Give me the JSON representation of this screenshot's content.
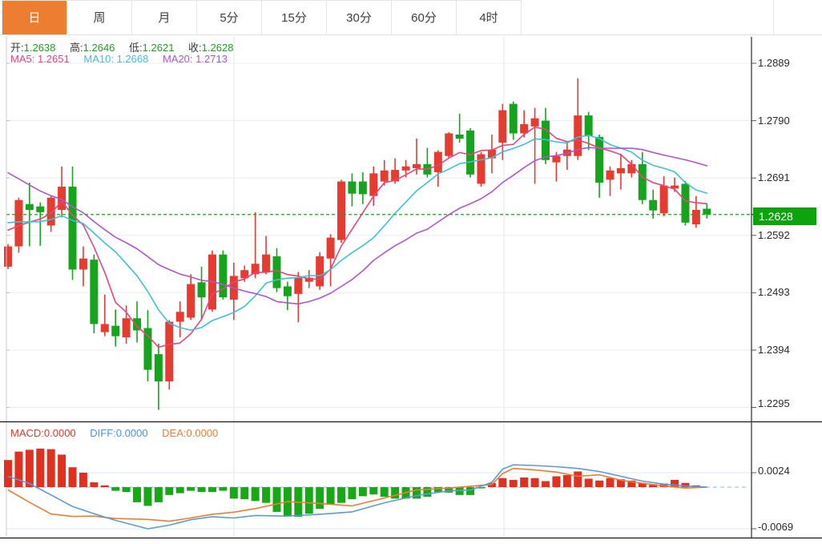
{
  "tabs": {
    "items": [
      {
        "label": "日",
        "active": true
      },
      {
        "label": "周",
        "active": false
      },
      {
        "label": "月",
        "active": false
      },
      {
        "label": "5分",
        "active": false
      },
      {
        "label": "15分",
        "active": false
      },
      {
        "label": "30分",
        "active": false
      },
      {
        "label": "60分",
        "active": false
      },
      {
        "label": "4时",
        "active": false
      }
    ]
  },
  "ohlc_legend": {
    "open_label": "开:",
    "open": "1.2638",
    "high_label": "高:",
    "high": "1.2646",
    "low_label": "低:",
    "low": "1.2621",
    "close_label": "收:",
    "close": "1.2628"
  },
  "ma_legend": {
    "ma5_label": "MA5:",
    "ma5": "1.2651",
    "ma10_label": "MA10:",
    "ma10": "1.2668",
    "ma20_label": "MA20:",
    "ma20": "1.2713"
  },
  "macd_legend": {
    "macd_label": "MACD:",
    "macd": "0.0000",
    "diff_label": "DIFF:",
    "diff": "0.0000",
    "dea_label": "DEA:",
    "dea": "0.0000"
  },
  "price_axis": {
    "ticks": [
      "1.2889",
      "1.2790",
      "1.2691",
      "1.2592",
      "1.2493",
      "1.2394",
      "1.2295"
    ],
    "current": "1.2628"
  },
  "macd_axis": {
    "ticks": [
      "0.0024",
      "-0.0069"
    ]
  },
  "colors": {
    "up": "#e53b30",
    "down": "#16a41e",
    "hist_up": "#e03020",
    "hist_down": "#17a717",
    "ma5": "#e8447d",
    "ma10": "#3ec0d8",
    "ma20": "#b156c9",
    "diff": "#5b9bd5",
    "dea": "#ed7d31",
    "current_line": "#1ea21e",
    "badge": "#0ca40c",
    "grid_h": "#e8eef6",
    "grid_v": "#dce7f2",
    "axis_left": "#c9ced4",
    "axis_right": "#3c3c3c",
    "separator": "#1a1a1a",
    "zero_dashed": "#8fc1e8",
    "tab_active_bg": "#ed7d31"
  },
  "chart_data": [
    {
      "type": "candlestick",
      "title": "日K with MA5/MA10/MA20",
      "y_ticks": [
        1.2889,
        1.279,
        1.2691,
        1.2592,
        1.2493,
        1.2394,
        1.2295
      ],
      "current_price": 1.2628,
      "ma_periods": [
        5,
        10,
        20
      ],
      "ma_lead_in_closes": [
        1.286,
        1.285,
        1.2838,
        1.2822,
        1.2804,
        1.2784,
        1.2762,
        1.2742,
        1.272,
        1.2678,
        1.264,
        1.2635,
        1.263,
        1.262,
        1.261,
        1.2615,
        1.2605,
        1.2605,
        1.2607
      ],
      "candles": [
        [
          1.2538,
          1.2577,
          1.2534,
          1.2573
        ],
        [
          1.2573,
          1.2657,
          1.2562,
          1.2653
        ],
        [
          1.2646,
          1.2683,
          1.2573,
          1.2636
        ],
        [
          1.2642,
          1.2649,
          1.2574,
          1.2632
        ],
        [
          1.2609,
          1.2661,
          1.2598,
          1.2657
        ],
        [
          1.2636,
          1.2711,
          1.2623,
          1.2676
        ],
        [
          1.2676,
          1.2711,
          1.2515,
          1.2533
        ],
        [
          1.2533,
          1.2573,
          1.2504,
          1.2552
        ],
        [
          1.255,
          1.2559,
          1.2423,
          1.2439
        ],
        [
          1.2425,
          1.249,
          1.2418,
          1.2439
        ],
        [
          1.2436,
          1.2464,
          1.24,
          1.2418
        ],
        [
          1.2416,
          1.2471,
          1.2405,
          1.2449
        ],
        [
          1.2449,
          1.2478,
          1.2407,
          1.2428
        ],
        [
          1.2432,
          1.2463,
          1.234,
          1.236
        ],
        [
          1.2387,
          1.2405,
          1.2291,
          1.234
        ],
        [
          1.234,
          1.2446,
          1.2326,
          1.2443
        ],
        [
          1.2443,
          1.2478,
          1.2416,
          1.246
        ],
        [
          1.245,
          1.2525,
          1.2446,
          1.2508
        ],
        [
          1.2511,
          1.2538,
          1.2446,
          1.2485
        ],
        [
          1.2464,
          1.2566,
          1.246,
          1.2559
        ],
        [
          1.2559,
          1.2566,
          1.2481,
          1.2485
        ],
        [
          1.2481,
          1.2545,
          1.2446,
          1.2522
        ],
        [
          1.2518,
          1.254,
          1.2512,
          1.2532
        ],
        [
          1.2525,
          1.2632,
          1.2518,
          1.2543
        ],
        [
          1.2529,
          1.2591,
          1.2525,
          1.2559
        ],
        [
          1.2556,
          1.257,
          1.2494,
          1.2501
        ],
        [
          1.2504,
          1.2512,
          1.2463,
          1.2487
        ],
        [
          1.2491,
          1.2529,
          1.2442,
          1.2519
        ],
        [
          1.2512,
          1.2532,
          1.2501,
          1.2519
        ],
        [
          1.2504,
          1.2563,
          1.2498,
          1.2556
        ],
        [
          1.2552,
          1.2594,
          1.2504,
          1.2588
        ],
        [
          1.2584,
          1.2688,
          1.2579,
          1.2685
        ],
        [
          1.2685,
          1.2699,
          1.2642,
          1.2664
        ],
        [
          1.2685,
          1.2701,
          1.2646,
          1.2663
        ],
        [
          1.266,
          1.2711,
          1.2643,
          1.2699
        ],
        [
          1.2685,
          1.2722,
          1.2678,
          1.2704
        ],
        [
          1.2685,
          1.2725,
          1.2681,
          1.2705
        ],
        [
          1.2704,
          1.2722,
          1.2692,
          1.2711
        ],
        [
          1.2708,
          1.2759,
          1.2697,
          1.2715
        ],
        [
          1.2715,
          1.2743,
          1.2692,
          1.2697
        ],
        [
          1.2701,
          1.2739,
          1.2676,
          1.2736
        ],
        [
          1.2729,
          1.277,
          1.2725,
          1.2768
        ],
        [
          1.2766,
          1.2802,
          1.2752,
          1.2759
        ],
        [
          1.2773,
          1.2777,
          1.2692,
          1.2697
        ],
        [
          1.2681,
          1.2736,
          1.2676,
          1.2732
        ],
        [
          1.2725,
          1.2766,
          1.2699,
          1.274
        ],
        [
          1.2752,
          1.2819,
          1.2722,
          1.2808
        ],
        [
          1.2819,
          1.2823,
          1.2757,
          1.2768
        ],
        [
          1.2768,
          1.2808,
          1.2761,
          1.2784
        ],
        [
          1.278,
          1.2812,
          1.2681,
          1.2794
        ],
        [
          1.279,
          1.2812,
          1.2715,
          1.2722
        ],
        [
          1.2718,
          1.2736,
          1.2685,
          1.2729
        ],
        [
          1.2729,
          1.2754,
          1.2705,
          1.274
        ],
        [
          1.2729,
          1.2863,
          1.2722,
          1.2799
        ],
        [
          1.2799,
          1.2805,
          1.2739,
          1.2763
        ],
        [
          1.2762,
          1.2766,
          1.2657,
          1.2683
        ],
        [
          1.2688,
          1.2711,
          1.266,
          1.2704
        ],
        [
          1.2699,
          1.2733,
          1.2671,
          1.2708
        ],
        [
          1.2699,
          1.2722,
          1.2692,
          1.2715
        ],
        [
          1.2715,
          1.2736,
          1.2646,
          1.2653
        ],
        [
          1.2653,
          1.2671,
          1.2621,
          1.2635
        ],
        [
          1.263,
          1.2694,
          1.2625,
          1.2678
        ],
        [
          1.2673,
          1.2692,
          1.2667,
          1.2678
        ],
        [
          1.2681,
          1.2686,
          1.2609,
          1.2614
        ],
        [
          1.2611,
          1.266,
          1.2605,
          1.2636
        ],
        [
          1.2638,
          1.2646,
          1.2621,
          1.2628
        ]
      ]
    },
    {
      "type": "bar",
      "title": "MACD",
      "y_ticks": [
        0.0024,
        -0.0069
      ],
      "histogram": [
        0.0045,
        0.0059,
        0.0062,
        0.0064,
        0.0063,
        0.0054,
        0.0033,
        0.0024,
        0.0008,
        0.0003,
        -0.0006,
        -0.0008,
        -0.0025,
        -0.0031,
        -0.0025,
        -0.0013,
        -0.001,
        -0.0006,
        -0.0008,
        -0.0008,
        -0.0006,
        -0.0019,
        -0.002,
        -0.0023,
        -0.0026,
        -0.0041,
        -0.0048,
        -0.0049,
        -0.0044,
        -0.0036,
        -0.0029,
        -0.0026,
        -0.002,
        -0.0015,
        -0.0012,
        -0.0016,
        -0.0019,
        -0.0019,
        -0.0019,
        -0.0016,
        -0.0008,
        -0.0009,
        -0.0013,
        -0.0013,
        -0.0002,
        0.0007,
        0.0015,
        0.0012,
        0.0016,
        0.0015,
        0.001,
        0.0018,
        0.002,
        0.0026,
        0.0014,
        0.0011,
        0.0015,
        0.0013,
        0.0011,
        0.0007,
        0.0005,
        0.0006,
        0.0012,
        0.0007,
        0.0003,
        0.0
      ],
      "diff_points": [
        [
          0,
          0.0018
        ],
        [
          2,
          0.0006
        ],
        [
          4,
          -0.0013
        ],
        [
          6,
          -0.0032
        ],
        [
          8,
          -0.0044
        ],
        [
          10,
          -0.0055
        ],
        [
          13,
          -0.0069
        ],
        [
          15,
          -0.0063
        ],
        [
          17,
          -0.0054
        ],
        [
          19,
          -0.0049
        ],
        [
          21,
          -0.0051
        ],
        [
          23,
          -0.0047
        ],
        [
          26,
          -0.0048
        ],
        [
          29,
          -0.0045
        ],
        [
          32,
          -0.0041
        ],
        [
          35,
          -0.0026
        ],
        [
          38,
          -0.0014
        ],
        [
          41,
          -0.0006
        ],
        [
          43,
          -0.0005
        ],
        [
          45,
          0.0008
        ],
        [
          46,
          0.003
        ],
        [
          47,
          0.0037
        ],
        [
          49,
          0.0036
        ],
        [
          51,
          0.0034
        ],
        [
          53,
          0.0031
        ],
        [
          55,
          0.0026
        ],
        [
          57,
          0.0018
        ],
        [
          59,
          0.001
        ],
        [
          61,
          0.0005
        ],
        [
          63,
          0.0002
        ],
        [
          65,
          0.0
        ]
      ]
    }
  ]
}
